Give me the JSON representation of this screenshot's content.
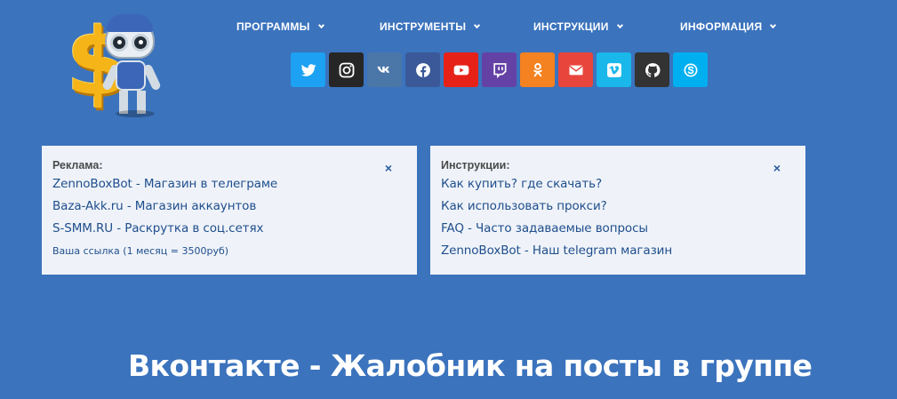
{
  "nav": {
    "items": [
      {
        "label": "ПРОГРАММЫ"
      },
      {
        "label": "ИНСТРУМЕНТЫ"
      },
      {
        "label": "ИНСТРУКЦИИ"
      },
      {
        "label": "ИНФОРМАЦИЯ"
      }
    ]
  },
  "social": [
    {
      "icon": "twitter-icon",
      "color": "#1da1f2"
    },
    {
      "icon": "instagram-icon",
      "color": "#262626"
    },
    {
      "icon": "vk-icon",
      "color": "#4a76a8"
    },
    {
      "icon": "facebook-icon",
      "color": "#3b5998"
    },
    {
      "icon": "youtube-icon",
      "color": "#e62117"
    },
    {
      "icon": "twitch-icon",
      "color": "#6441a5"
    },
    {
      "icon": "odnoklassniki-icon",
      "color": "#f58220"
    },
    {
      "icon": "envelope-icon",
      "color": "#e8453c"
    },
    {
      "icon": "vimeo-icon",
      "color": "#1ab7ea"
    },
    {
      "icon": "github-icon",
      "color": "#333333"
    },
    {
      "icon": "skype-icon",
      "color": "#00aff0"
    }
  ],
  "ads_box": {
    "title": "Реклама:",
    "close": "×",
    "links": [
      "ZennoBoxBot - Магазин в телеграме",
      "Baza-Akk.ru - Магазин аккаунтов",
      "S-SMM.RU - Раскрутка в соц.сетях"
    ],
    "note": "Ваша ссылка (1 месяц = 3500руб)"
  },
  "guides_box": {
    "title": "Инструкции:",
    "close": "×",
    "links": [
      "Как купить? где скачать?",
      "Как использовать прокси?",
      "FAQ - Часто задаваемые вопросы",
      "ZennoBoxBot - Наш telegram магазин"
    ]
  },
  "page_title": "Вконтакте - Жалобник на посты в группе",
  "colors": {
    "background": "#3b73bd",
    "box_background": "#eff3f9",
    "link": "#1f4e8c"
  }
}
